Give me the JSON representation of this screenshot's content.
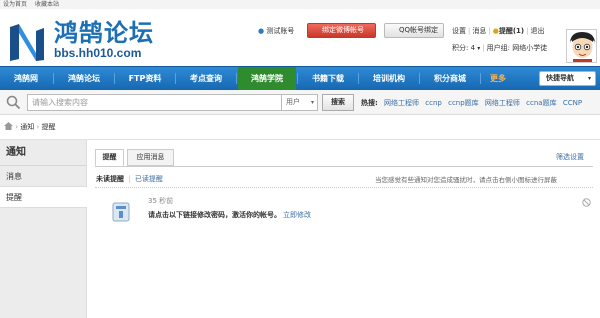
{
  "top_strip": {
    "set_home": "设为首页",
    "bookmark": "收藏本站"
  },
  "brand": {
    "logo_text": "鸿鹄论坛",
    "url": "bbs.hh010.com"
  },
  "user_bar": {
    "test_account": "测试账号",
    "bind_weibo": "绑定微博帐号",
    "qq_bind": "QQ帐号绑定",
    "settings": "设置",
    "messages": "消息",
    "reminders": "提醒(1)",
    "logout": "退出",
    "points": "积分: 4",
    "user_group": "用户组: 网络小学徒"
  },
  "nav": {
    "items": [
      "鸿鹄网",
      "鸿鹄论坛",
      "FTP资料",
      "考点查询",
      "鸿鹄学院",
      "书籍下载",
      "培训机构",
      "积分商城",
      "更多"
    ],
    "quick_nav": "快捷导航"
  },
  "search": {
    "placeholder": "请输入搜索内容",
    "type": "用户",
    "button": "搜索",
    "hot_label": "热搜:",
    "hot_terms": [
      "网络工程师",
      "ccnp",
      "ccnp题库",
      "网络工程师",
      "ccna题库",
      "CCNP"
    ]
  },
  "breadcrumb": {
    "notice": "通知",
    "remind": "提醒"
  },
  "sidebar": {
    "title": "通知",
    "items": [
      "消息",
      "提醒"
    ]
  },
  "main": {
    "tabs": [
      "提醒",
      "应用消息"
    ],
    "filter_settings": "筛选设置",
    "subtab_unread": "未读提醒",
    "subtab_read": "已读提醒",
    "hint": "当您感觉有些通知对您造成骚扰时，请点击右侧小图标进行屏蔽",
    "notice": {
      "time": "35 秒前",
      "message": "请点击以下链接修改密码，激活你的帐号。",
      "link": "立即修改"
    }
  },
  "colors": {
    "nav_bg": "#1b74c2",
    "nav_active": "#2e8b2e",
    "link": "#3a6ea5",
    "accent_red": "#d9412f"
  }
}
